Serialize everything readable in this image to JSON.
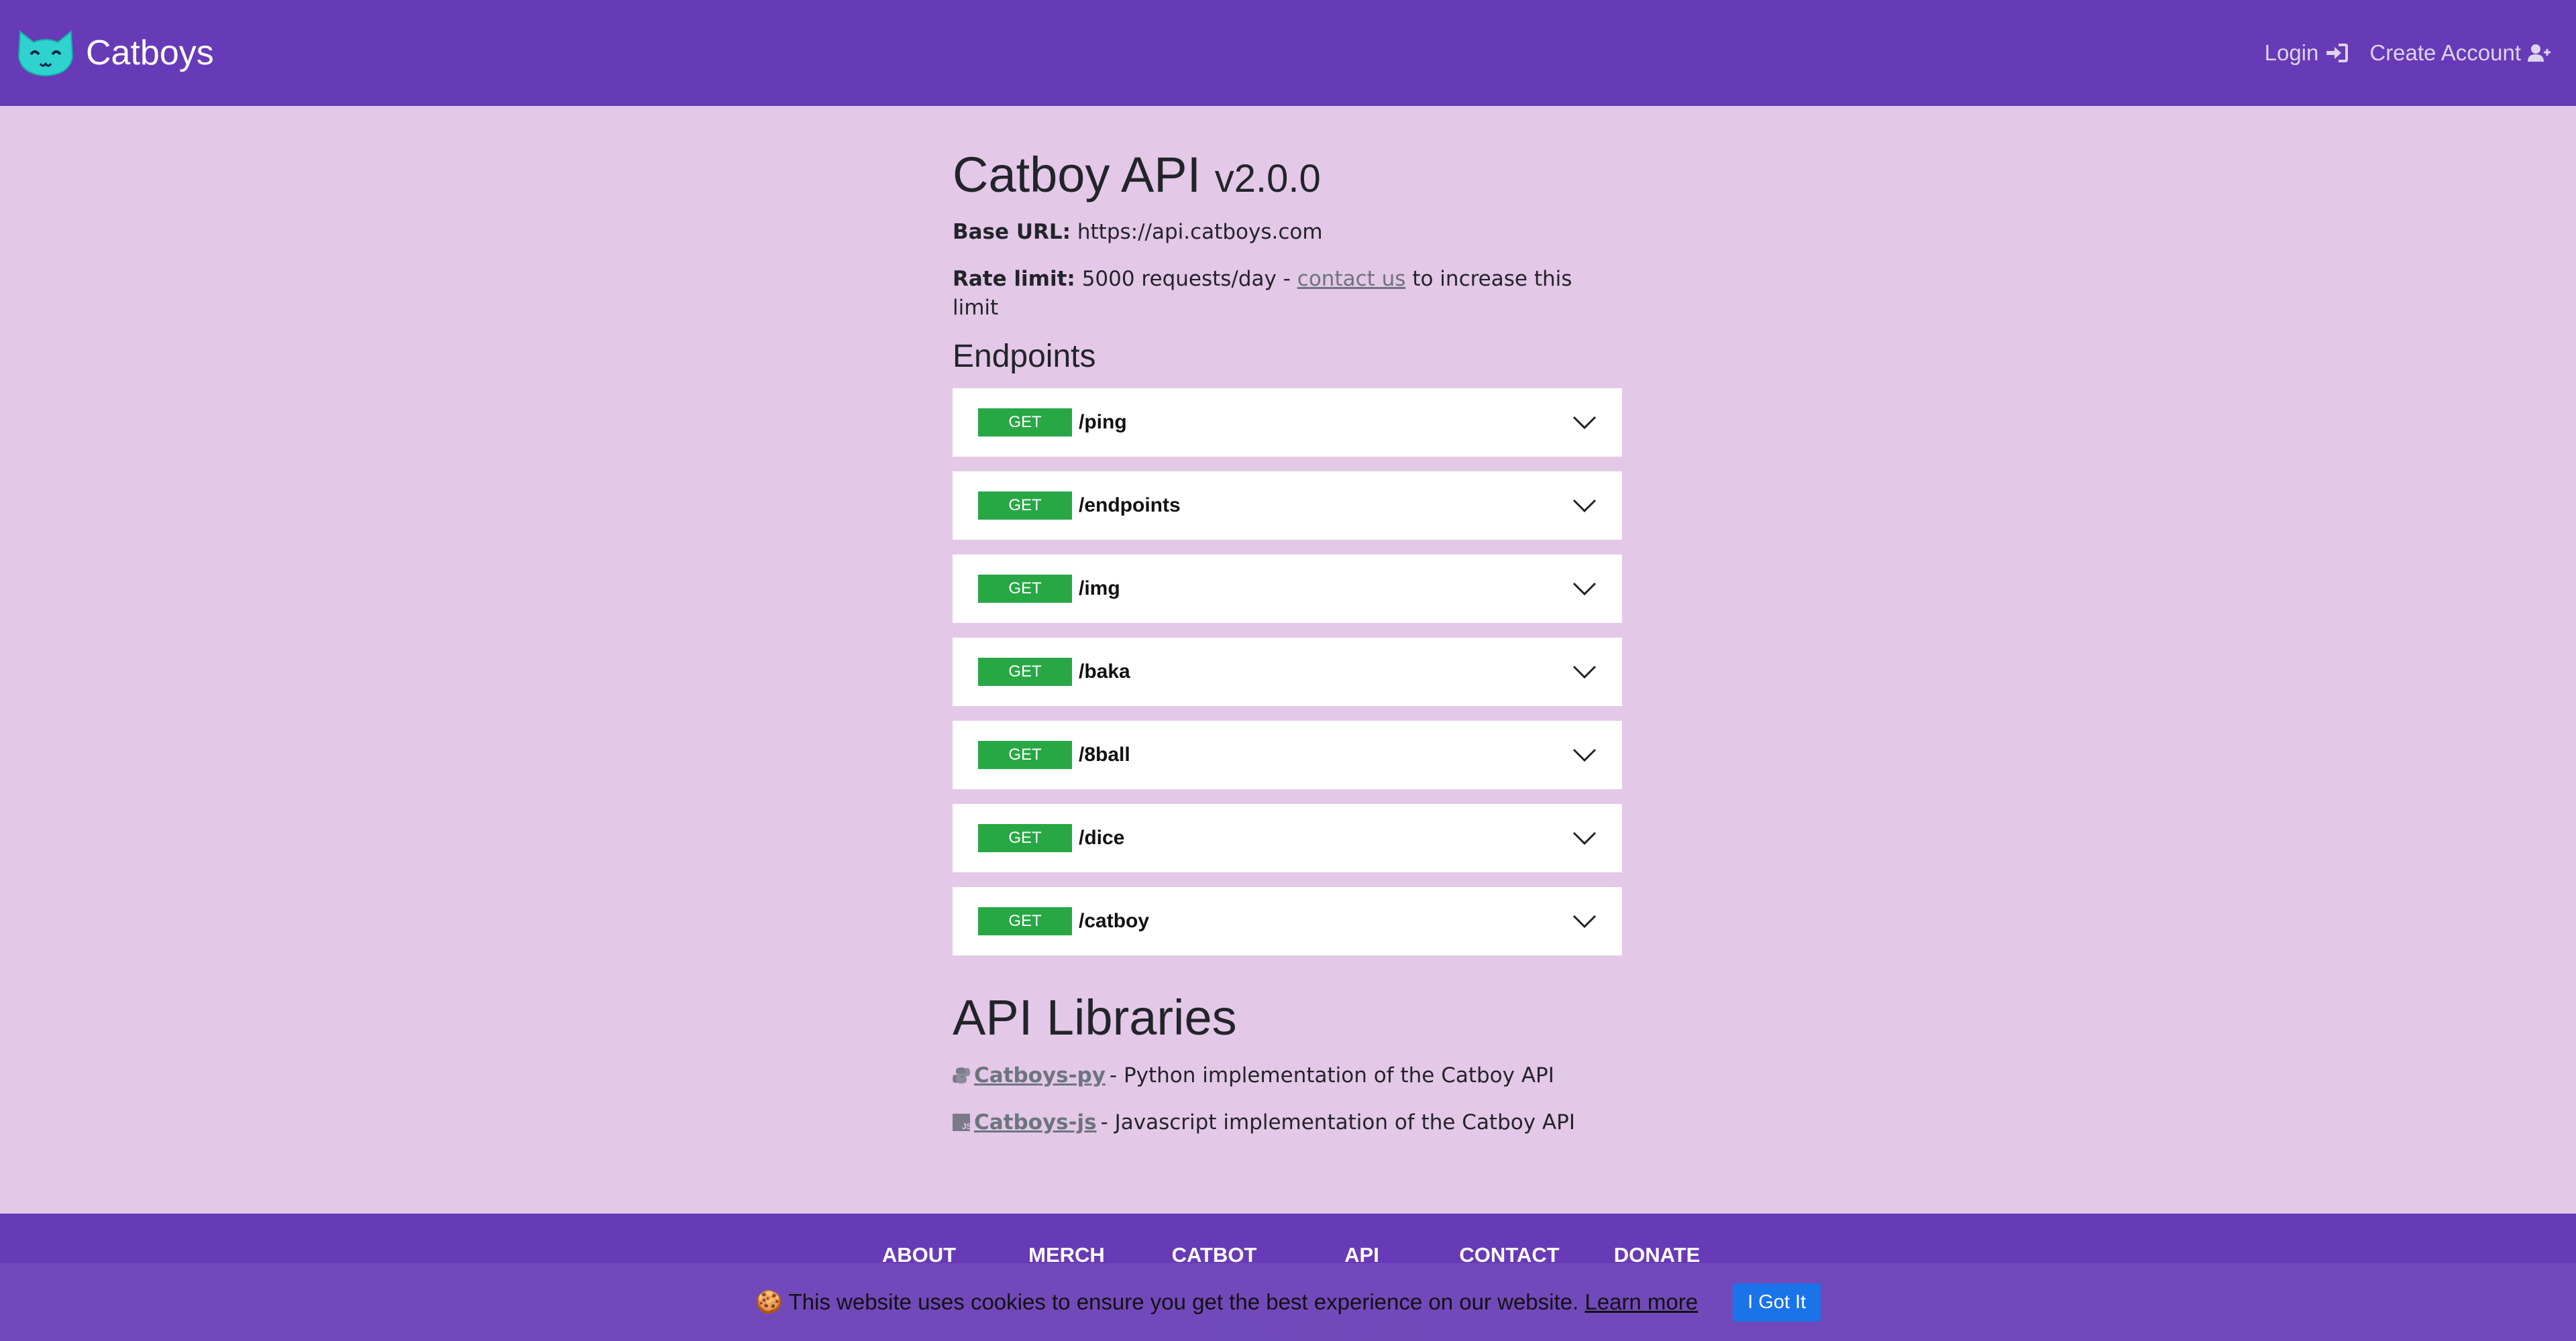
{
  "navbar": {
    "brand": "Catboys",
    "login": "Login",
    "create_account": "Create Account"
  },
  "main": {
    "title": "Catboy API",
    "version": "v2.0.0",
    "base_url_label": "Base URL:",
    "base_url": "https://api.catboys.com",
    "rate_limit_label": "Rate limit:",
    "rate_limit_value": "5000 requests/day -",
    "contact_link": "contact us",
    "rate_limit_suffix": "to increase this limit",
    "endpoints_heading": "Endpoints",
    "endpoints": [
      {
        "method": "GET",
        "path": "/ping"
      },
      {
        "method": "GET",
        "path": "/endpoints"
      },
      {
        "method": "GET",
        "path": "/img"
      },
      {
        "method": "GET",
        "path": "/baka"
      },
      {
        "method": "GET",
        "path": "/8ball"
      },
      {
        "method": "GET",
        "path": "/dice"
      },
      {
        "method": "GET",
        "path": "/catboy"
      }
    ],
    "libraries_heading": "API Libraries",
    "libraries": [
      {
        "icon": "python-icon",
        "name": "Catboys-py",
        "desc": "- Python implementation of the Catboy API"
      },
      {
        "icon": "javascript-icon",
        "name": "Catboys-js",
        "desc": "- Javascript implementation of the Catboy API"
      }
    ]
  },
  "footer": {
    "links": [
      "ABOUT",
      "MERCH",
      "CATBOT",
      "API",
      "CONTACT",
      "DONATE"
    ]
  },
  "cookie": {
    "text": "🍪 This website uses cookies to ensure you get the best experience on our website.",
    "learn_more": "Learn more",
    "button": "I Got It"
  },
  "colors": {
    "nav_bg": "#673ab7",
    "page_bg": "#e4c8e8",
    "method_green": "#28a745",
    "cookie_button": "#1a73e8",
    "logo_cyan": "#2ed3cf"
  }
}
